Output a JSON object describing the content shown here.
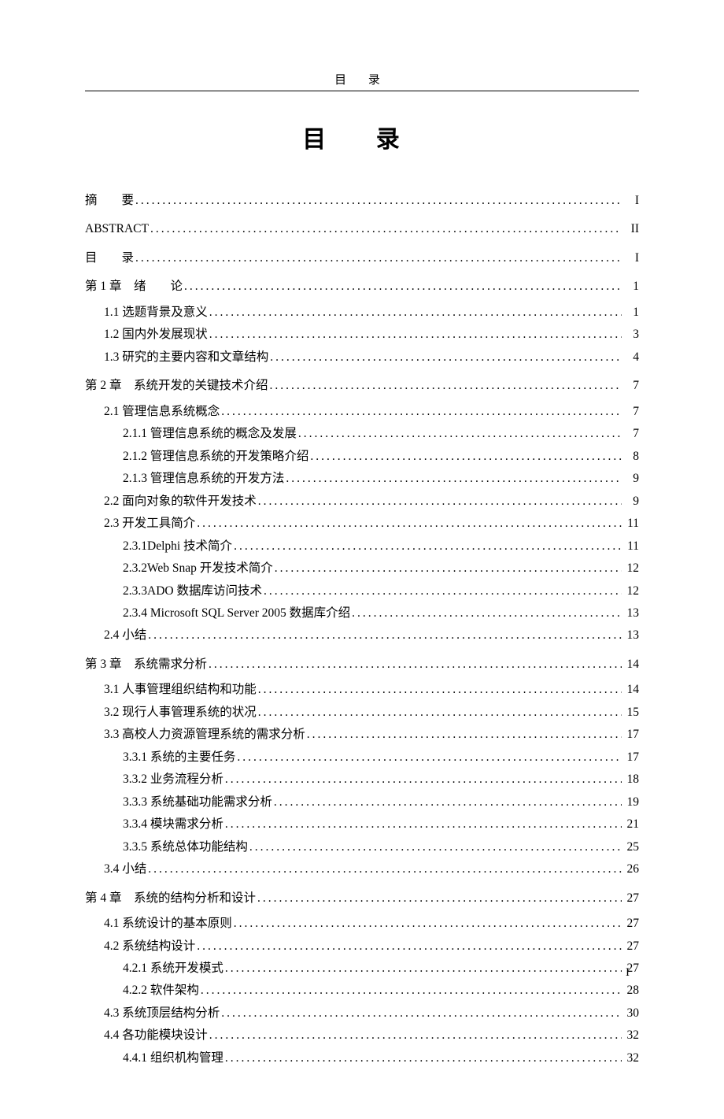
{
  "running_head": "目  录",
  "title": "目    录",
  "page_number": "I",
  "dots": "................................................................................................................................................",
  "toc": [
    {
      "label": "摘　　要",
      "page": "I",
      "level": 0,
      "chapter": true,
      "first": true
    },
    {
      "label": "ABSTRACT",
      "page": "II",
      "level": 0,
      "chapter": true
    },
    {
      "label": "目　　录",
      "page": "I",
      "level": 0,
      "chapter": true
    },
    {
      "label": "第 1 章　绪　　论",
      "page": "1",
      "level": 0,
      "chapter": true
    },
    {
      "label": "1.1 选题背景及意义",
      "page": "1",
      "level": 1
    },
    {
      "label": "1.2 国内外发展现状",
      "page": "3",
      "level": 1
    },
    {
      "label": "1.3 研究的主要内容和文章结构",
      "page": "4",
      "level": 1
    },
    {
      "label": "第 2 章　系统开发的关键技术介绍",
      "page": "7",
      "level": 0,
      "chapter": true
    },
    {
      "label": "2.1 管理信息系统概念",
      "page": "7",
      "level": 1
    },
    {
      "label": "2.1.1 管理信息系统的概念及发展",
      "page": "7",
      "level": 2
    },
    {
      "label": "2.1.2 管理信息系统的开发策略介绍",
      "page": "8",
      "level": 2
    },
    {
      "label": "2.1.3 管理信息系统的开发方法",
      "page": "9",
      "level": 2
    },
    {
      "label": "2.2 面向对象的软件开发技术",
      "page": "9",
      "level": 1
    },
    {
      "label": "2.3 开发工具简介",
      "page": "11",
      "level": 1
    },
    {
      "label": "2.3.1Delphi 技术简介",
      "page": "11",
      "level": 2
    },
    {
      "label": "2.3.2Web Snap 开发技术简介",
      "page": "12",
      "level": 2
    },
    {
      "label": "2.3.3ADO 数据库访问技术",
      "page": "12",
      "level": 2
    },
    {
      "label": "2.3.4 Microsoft SQL Server 2005 数据库介绍",
      "page": "13",
      "level": 2
    },
    {
      "label": "2.4 小结",
      "page": "13",
      "level": 1
    },
    {
      "label": "第 3 章　系统需求分析",
      "page": "14",
      "level": 0,
      "chapter": true
    },
    {
      "label": "3.1 人事管理组织结构和功能",
      "page": "14",
      "level": 1
    },
    {
      "label": "3.2 现行人事管理系统的状况",
      "page": "15",
      "level": 1
    },
    {
      "label": "3.3 高校人力资源管理系统的需求分析",
      "page": "17",
      "level": 1
    },
    {
      "label": "3.3.1 系统的主要任务",
      "page": "17",
      "level": 2
    },
    {
      "label": "3.3.2 业务流程分析",
      "page": "18",
      "level": 2
    },
    {
      "label": "3.3.3 系统基础功能需求分析",
      "page": "19",
      "level": 2
    },
    {
      "label": "3.3.4 模块需求分析",
      "page": "21",
      "level": 2
    },
    {
      "label": "3.3.5 系统总体功能结构",
      "page": "25",
      "level": 2
    },
    {
      "label": "3.4 小结",
      "page": "26",
      "level": 1
    },
    {
      "label": "第 4 章　系统的结构分析和设计",
      "page": "27",
      "level": 0,
      "chapter": true
    },
    {
      "label": "4.1 系统设计的基本原则",
      "page": "27",
      "level": 1
    },
    {
      "label": "4.2 系统结构设计",
      "page": "27",
      "level": 1
    },
    {
      "label": "4.2.1 系统开发模式",
      "page": "27",
      "level": 2
    },
    {
      "label": "4.2.2 软件架构",
      "page": "28",
      "level": 2
    },
    {
      "label": "4.3 系统顶层结构分析",
      "page": "30",
      "level": 1
    },
    {
      "label": "4.4 各功能模块设计",
      "page": "32",
      "level": 1
    },
    {
      "label": "4.4.1 组织机构管理",
      "page": "32",
      "level": 2
    }
  ]
}
